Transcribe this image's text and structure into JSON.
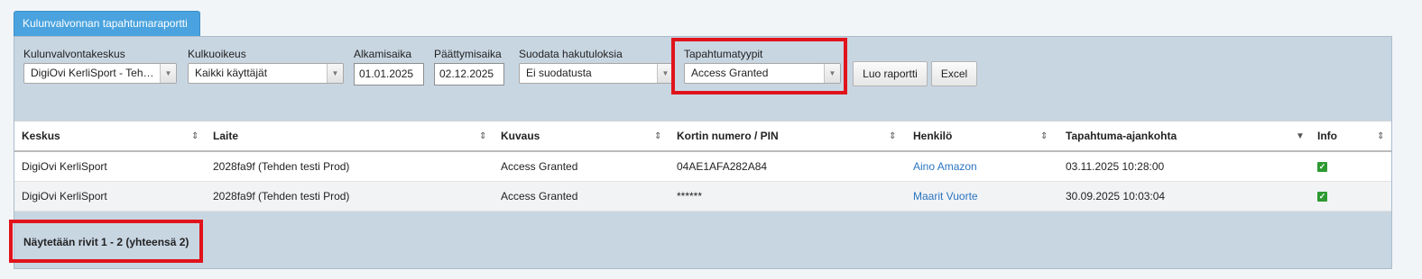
{
  "tab": {
    "label": "Kulunvalvonnan tapahtumaraportti"
  },
  "filters": {
    "center": {
      "label": "Kulunvalvontakeskus",
      "value": "DigiOvi KerliSport - Tehd..."
    },
    "access_right": {
      "label": "Kulkuoikeus",
      "value": "Kaikki käyttäjät"
    },
    "start": {
      "label": "Alkamisaika",
      "value": "01.01.2025"
    },
    "end": {
      "label": "Päättymisaika",
      "value": "02.12.2025"
    },
    "filter_results": {
      "label": "Suodata hakutuloksia",
      "value": "Ei suodatusta"
    },
    "event_types": {
      "label": "Tapahtumatyypit",
      "value": "Access Granted"
    }
  },
  "buttons": {
    "create_report": "Luo raportti",
    "excel": "Excel"
  },
  "table": {
    "columns": [
      "Keskus",
      "Laite",
      "Kuvaus",
      "Kortin numero / PIN",
      "Henkilö",
      "Tapahtuma-ajankohta",
      "Info"
    ],
    "rows": [
      {
        "center": "DigiOvi KerliSport",
        "device": "2028fa9f (Tehden testi Prod)",
        "description": "Access Granted",
        "card": "04AE1AFA282A84",
        "person": "Aino Amazon",
        "time": "03.11.2025 10:28:00",
        "info": true
      },
      {
        "center": "DigiOvi KerliSport",
        "device": "2028fa9f (Tehden testi Prod)",
        "description": "Access Granted",
        "card": "******",
        "person": "Maarit Vuorte",
        "time": "30.09.2025 10:03:04",
        "info": true
      }
    ]
  },
  "footer": {
    "summary": "Näytetään rivit 1 - 2 (yhteensä 2)"
  },
  "colors": {
    "tab": "#4aa3df",
    "panel": "#c8d6e2",
    "highlight": "#e0131b",
    "link": "#2a74c0",
    "check": "#2e9a32"
  },
  "icons": {
    "dropdown": "triangle-down-icon",
    "sort": "sort-updown-icon",
    "sort_desc": "sort-desc-icon",
    "info": "checkbox-checked-icon"
  }
}
